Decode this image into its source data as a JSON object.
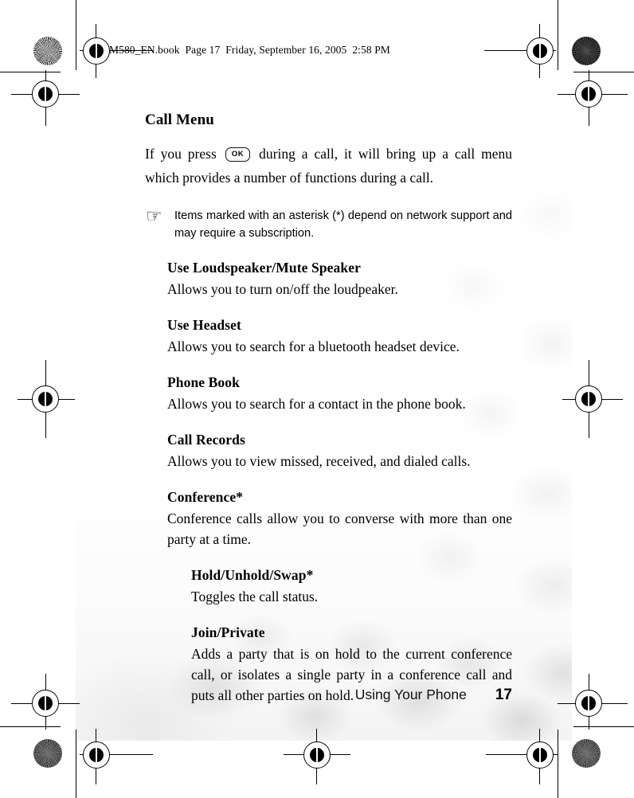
{
  "header": {
    "slug": "M580_EN.book  Page 17  Friday, September 16, 2005  2:58 PM"
  },
  "content": {
    "chapter_title": "Call Menu",
    "intro_part1": "If you press",
    "intro_key": "OK",
    "intro_part2": "during a call, it will bring up a call menu which provides a number of functions during a call.",
    "note": {
      "icon": "☞",
      "text": "Items marked with an asterisk (*) depend on network support and may require a subscription."
    },
    "items": [
      {
        "title": "Use Loudspeaker/Mute Speaker",
        "desc": "Allows you to turn on/off the loudpeaker.",
        "level": 1
      },
      {
        "title": "Use Headset",
        "desc": "Allows you to search for a bluetooth headset device.",
        "level": 1
      },
      {
        "title": "Phone Book",
        "desc": "Allows you to search for a contact in the phone book.",
        "level": 1
      },
      {
        "title": "Call Records",
        "desc": "Allows you to view missed, received, and dialed calls.",
        "level": 1
      },
      {
        "title": "Conference*",
        "desc": "Conference calls allow you to converse with more than one party at a time.",
        "level": 1
      },
      {
        "title": "Hold/Unhold/Swap*",
        "desc": "Toggles the call status.",
        "level": 2
      },
      {
        "title": "Join/Private",
        "desc": "Adds a party that is on hold to the current conference call, or isolates a single party in a conference call and puts all other parties on hold.",
        "level": 2
      }
    ]
  },
  "footer": {
    "section_label": "Using Your Phone",
    "page_number": "17"
  },
  "print_marks": {
    "registration_icon": "registration-target",
    "star_icon": "star-density-target"
  },
  "colors": {
    "ink": "#000000",
    "paper": "#ffffff",
    "texture": "#f2f2f2"
  }
}
